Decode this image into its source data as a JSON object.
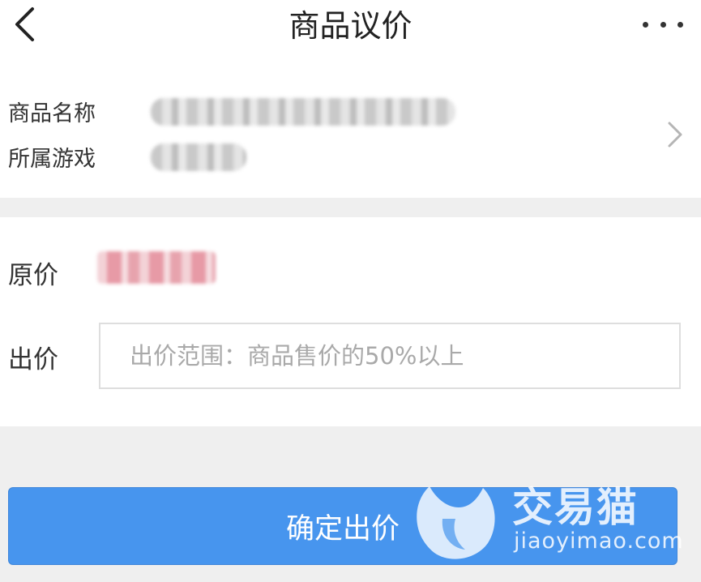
{
  "header": {
    "title": "商品议价",
    "back_icon": "chevron-left-icon",
    "more_icon": "more-horizontal-icon"
  },
  "product_info": {
    "name_label": "商品名称",
    "game_label": "所属游戏",
    "chevron_icon": "chevron-right-icon"
  },
  "pricing": {
    "original_label": "原价",
    "bid_label": "出价",
    "bid_placeholder": "出价范围：商品售价的50%以上",
    "bid_value": ""
  },
  "actions": {
    "confirm_label": "确定出价"
  },
  "watermark": {
    "brand": "交易猫",
    "url": "jiaoyimao.com"
  },
  "colors": {
    "accent": "#4795ee",
    "background": "#efefef",
    "card": "#ffffff",
    "price_highlight": "#e79aa6"
  }
}
